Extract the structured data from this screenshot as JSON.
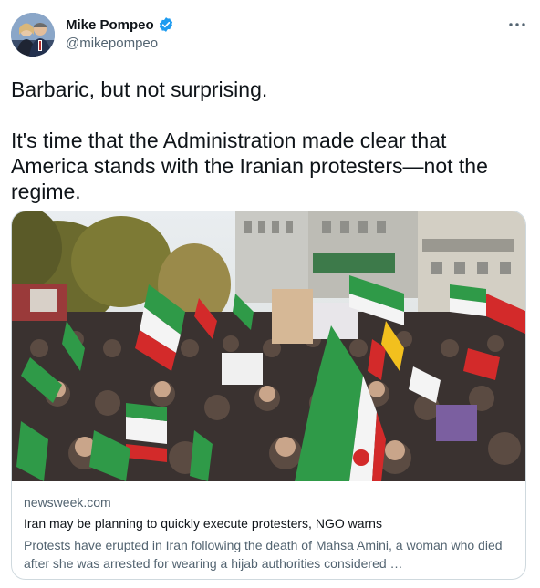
{
  "author": {
    "display_name": "Mike Pompeo",
    "handle": "@mikepompeo",
    "verified": true
  },
  "tweet": {
    "text": "Barbaric, but not surprising.\n\nIt's time that the Administration made clear that America stands with the Iranian protesters—not the regime."
  },
  "link_card": {
    "domain": "newsweek.com",
    "title": "Iran may be planning to quickly execute protesters, NGO warns",
    "description": "Protests have erupted in Iran following the death of Mahsa Amini, a woman who died after she was arrested for wearing a hijab authorities considered …"
  },
  "icons": {
    "verified": "verified-badge-icon",
    "more": "more-options-icon"
  },
  "colors": {
    "accent": "#1d9bf0",
    "text_primary": "#0f1419",
    "text_secondary": "#536471",
    "border": "#cfd9de"
  }
}
